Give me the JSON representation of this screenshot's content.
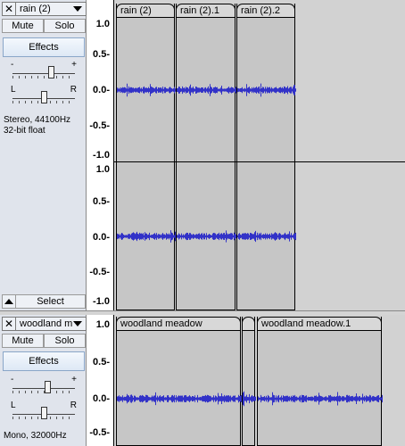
{
  "tracks": [
    {
      "name": "rain (2)",
      "mute": "Mute",
      "solo": "Solo",
      "effects": "Effects",
      "gain_minus": "-",
      "gain_plus": "+",
      "pan_l": "L",
      "pan_r": "R",
      "info_line1": "Stereo, 44100Hz",
      "info_line2": "32-bit float",
      "select": "Select",
      "ruler_labels_upper": [
        "1.0",
        "0.5-",
        "0.0-",
        "-0.5-",
        "-1.0"
      ],
      "ruler_labels_lower": [
        "1.0",
        "0.5-",
        "0.0-",
        "-0.5-",
        "-1.0"
      ],
      "clips": [
        "rain (2)",
        "rain (2).1",
        "rain (2).2"
      ]
    },
    {
      "name": "woodland m",
      "mute": "Mute",
      "solo": "Solo",
      "effects": "Effects",
      "gain_minus": "-",
      "gain_plus": "+",
      "pan_l": "L",
      "pan_r": "R",
      "info_line1": "Mono, 32000Hz",
      "ruler_labels": [
        "1.0",
        "0.5-",
        "0.0-",
        "-0.5-"
      ],
      "clips": [
        "woodland meadow",
        "",
        "woodland meadow.1"
      ]
    }
  ],
  "icons": {
    "close": "close-icon",
    "menu": "chevron-down-icon",
    "collapse": "collapse-up-icon"
  },
  "colors": {
    "waveform": "#3232c8",
    "clip_bg": "#c6c6c6",
    "panel_bg": "#e0e4ec"
  }
}
